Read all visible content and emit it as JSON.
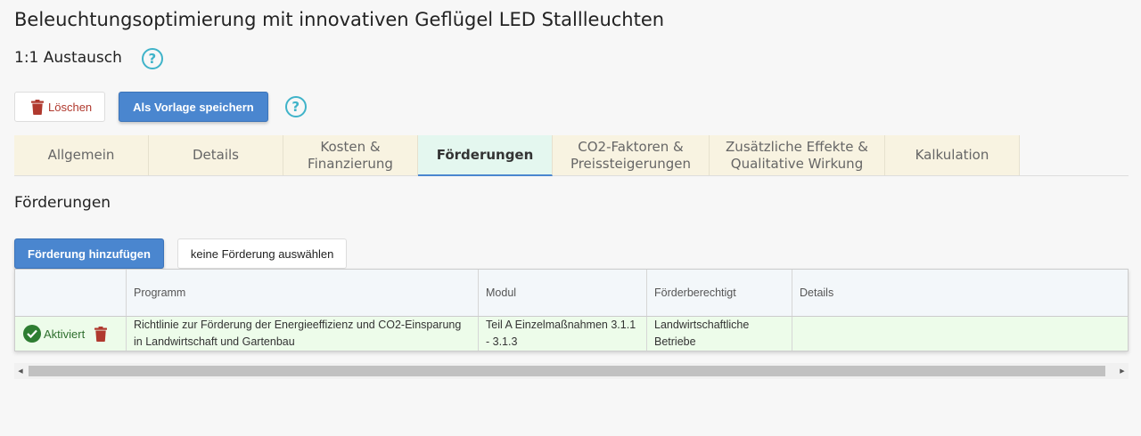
{
  "page": {
    "title": "Beleuchtungsoptimierung mit innovativen Geflügel LED Stallleuchten",
    "subtitle": "1:1 Austausch"
  },
  "toolbar": {
    "delete_label": "Löschen",
    "save_template_label": "Als Vorlage speichern"
  },
  "help_icon_glyph": "?",
  "tabs": [
    {
      "label": "Allgemein"
    },
    {
      "label": "Details"
    },
    {
      "label": "Kosten &\nFinanzierung"
    },
    {
      "label": "Förderungen",
      "active": true
    },
    {
      "label": "CO2-Faktoren &\nPreissteigerungen"
    },
    {
      "label": "Zusätzliche Effekte &\nQualitative Wirkung"
    },
    {
      "label": "Kalkulation"
    }
  ],
  "section": {
    "title": "Förderungen",
    "add_label": "Förderung hinzufügen",
    "none_label": "keine Förderung auswählen"
  },
  "grid": {
    "columns": [
      "",
      "Programm",
      "Modul",
      "Förderberechtigt",
      "Details"
    ],
    "rows": [
      {
        "status": "Aktiviert",
        "programm": "Richtlinie zur Förderung der Energieeffizienz und CO2-Einsparung in Landwirtschaft und Gartenbau",
        "modul": "Teil A Einzelmaßnahmen 3.1.1 - 3.1.3",
        "foerderberechtigt": "Landwirtschaftliche Betriebe",
        "details": ""
      }
    ]
  },
  "colors": {
    "accent": "#4a86cf",
    "help": "#3fb3c9",
    "delete": "#b0392e",
    "success": "#2e7d32",
    "tab_bg": "#f8f3e1",
    "tab_active_bg": "#e4f7ef",
    "row_bg": "#edfcea"
  },
  "icons": [
    "help-icon",
    "trash-icon",
    "check-circle-icon",
    "scroll-left-icon",
    "scroll-right-icon"
  ]
}
